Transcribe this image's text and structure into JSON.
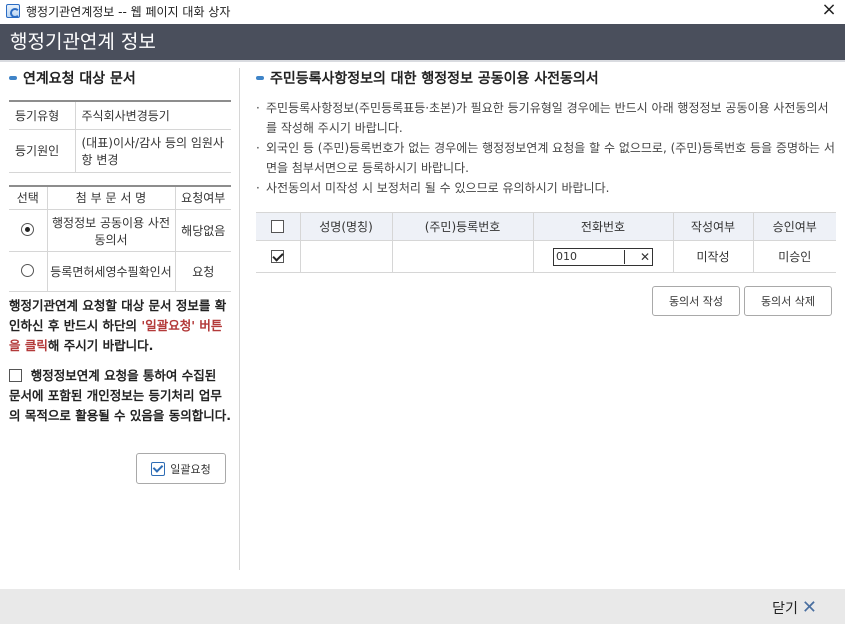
{
  "window": {
    "title": "행정기관연계정보 -- 웹 페이지 대화 상자",
    "close_icon": "×"
  },
  "header": {
    "title": "행정기관연계 정보"
  },
  "left": {
    "section_title": "연계요청 대상 문서",
    "info": [
      {
        "label": "등기유형",
        "value": "주식회사변경등기"
      },
      {
        "label": "등기원인",
        "value": "(대표)이사/감사 등의 임원사항 변경"
      }
    ],
    "docs": {
      "headers": [
        "선택",
        "첨 부 문 서 명",
        "요청여부"
      ],
      "rows": [
        {
          "selected": true,
          "name": "행정정보 공동이용 사전동의서",
          "status": "해당없음"
        },
        {
          "selected": false,
          "name": "등록면허세영수필확인서",
          "status": "요청"
        }
      ]
    },
    "notice_pre": "행정기관연계 요청할 대상 문서 정보를 확인하신 후 반드시 하단의 ",
    "notice_red": "'일괄요청' 버튼을 클릭",
    "notice_post": "해 주시기 바랍니다.",
    "agree_text": "행정정보연계 요청을 통하여 수집된 문서에 포함된 개인정보는 등기처리 업무의 목적으로 활용될 수 있음을 동의합니다.",
    "bulk_button": "일괄요청"
  },
  "right": {
    "section_title": "주민등록사항정보의 대한 행정정보 공동이용 사전동의서",
    "notes": [
      "주민등록사항정보(주민등록표등·초본)가 필요한 등기유형일 경우에는 반드시 아래 행정정보 공동이용 사전동의서를 작성해 주시기 바랍니다.",
      "외국인 등 (주민)등록번호가 없는 경우에는 행정정보연계 요청을 할 수 없으므로, (주민)등록번호 등을 증명하는 서면을 첨부서면으로 등록하시기 바랍니다.",
      "사전동의서 미작성 시 보정처리 될 수 있으므로 유의하시기 바랍니다."
    ],
    "table": {
      "headers": [
        "성명(명칭)",
        "(주민)등록번호",
        "전화번호",
        "작성여부",
        "승인여부"
      ],
      "row": {
        "name": "",
        "reg_no": "",
        "phone": "010",
        "written": "미작성",
        "approved": "미승인",
        "checked": true
      }
    },
    "buttons": {
      "write": "동의서 작성",
      "delete": "동의서 삭제"
    }
  },
  "footer": {
    "close_label": "닫기"
  }
}
